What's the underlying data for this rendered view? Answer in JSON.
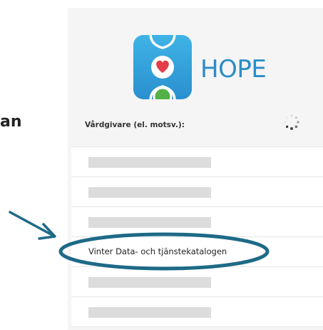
{
  "left_fragment": "an",
  "logo": {
    "icon": "hope-app-icon",
    "wordmark": "HOPE"
  },
  "provider": {
    "label": "Vårdgivare (el. motsv.):",
    "loading_icon": "spinner-icon"
  },
  "list": {
    "items": [
      {
        "label": ""
      },
      {
        "label": ""
      },
      {
        "label": ""
      },
      {
        "label": "Vinter Data- och tjänstekatalogen"
      },
      {
        "label": ""
      },
      {
        "label": ""
      }
    ]
  },
  "colors": {
    "brand_blue": "#2b8dc9",
    "annotation_teal": "#1d6a87",
    "heart_red": "#e23d48",
    "leaf_green": "#54b146"
  }
}
